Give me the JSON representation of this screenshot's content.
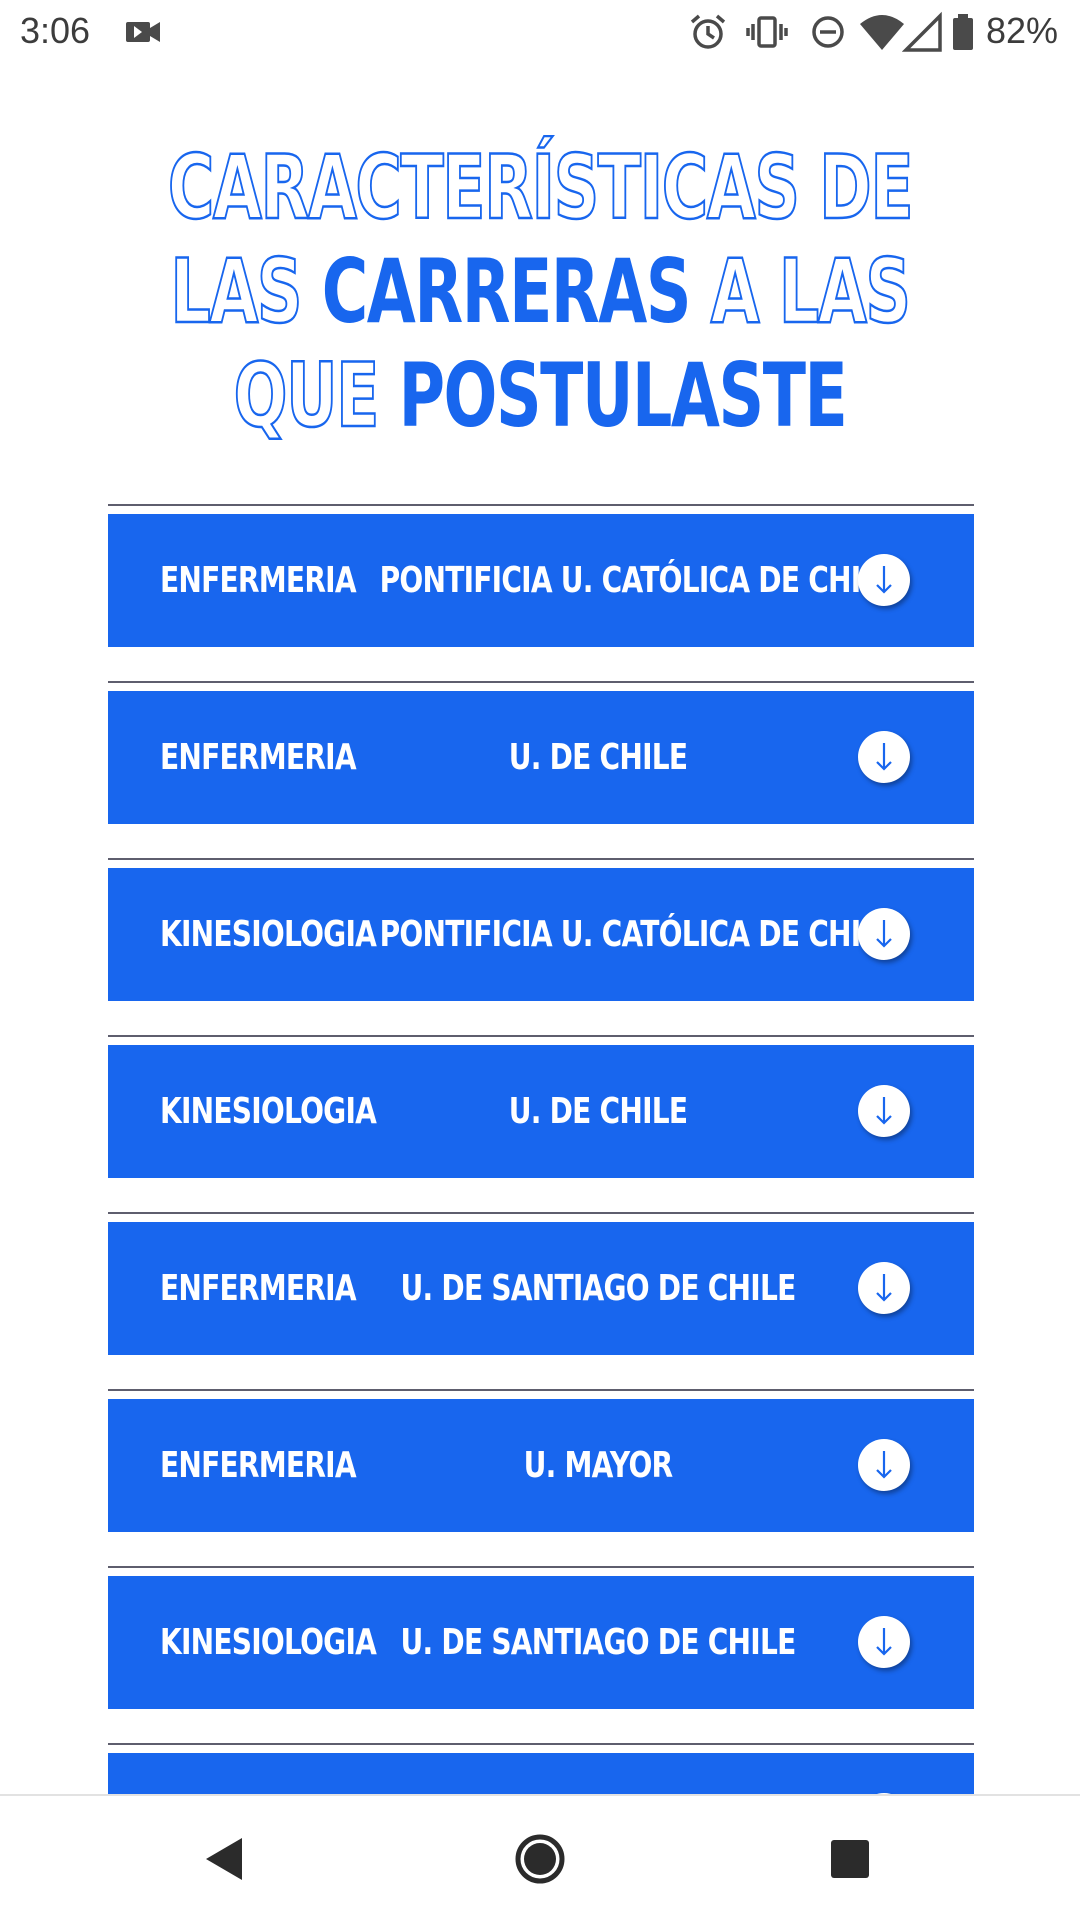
{
  "status_bar": {
    "time": "3:06",
    "battery": "82%",
    "icons": [
      "video-camera-icon",
      "alarm-icon",
      "vibrate-icon",
      "do-not-disturb-icon",
      "wifi-icon",
      "cellular-signal-icon",
      "battery-icon"
    ]
  },
  "title": {
    "line1_outline": "CARACTERÍSTICAS DE",
    "line2_outline_a": "LAS ",
    "line2_solid": "CARRERAS",
    "line2_outline_b": " A LAS",
    "line3_outline": "QUE ",
    "line3_solid": "POSTULASTE"
  },
  "careers": [
    {
      "career": "ENFERMERIA",
      "university": "PONTIFICIA U. CATÓLICA DE CHILE"
    },
    {
      "career": "ENFERMERIA",
      "university": "U. DE CHILE"
    },
    {
      "career": "KINESIOLOGIA",
      "university": "PONTIFICIA U. CATÓLICA DE CHILE"
    },
    {
      "career": "KINESIOLOGIA",
      "university": "U. DE CHILE"
    },
    {
      "career": "ENFERMERIA",
      "university": "U. DE SANTIAGO DE CHILE"
    },
    {
      "career": "ENFERMERIA",
      "university": "U. MAYOR"
    },
    {
      "career": "KINESIOLOGIA",
      "university": "U. DE SANTIAGO DE CHILE"
    },
    {
      "career": "",
      "university": ""
    }
  ],
  "colors": {
    "accent": "#1866ee",
    "card_text": "#ffffff",
    "divider": "#5e5e6e"
  },
  "nav_bar": {
    "icons": [
      "back-icon",
      "home-icon",
      "recents-icon"
    ]
  }
}
